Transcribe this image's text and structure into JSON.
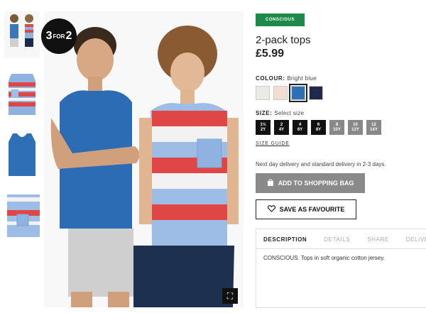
{
  "product": {
    "badge": {
      "big_left": "3",
      "small": "FOR",
      "big_right": "2"
    },
    "tag": "CONSCIOUS",
    "title": "2-pack tops",
    "price": "£5.99"
  },
  "colour": {
    "label": "COLOUR:",
    "value": "Bright blue",
    "swatches": [
      {
        "name": "light-grey",
        "color": "#eceae6"
      },
      {
        "name": "light-pink",
        "color": "#f1ddd2"
      },
      {
        "name": "bright-blue",
        "color": "#2f6fb5"
      },
      {
        "name": "dark-blue",
        "color": "#1f2a4a"
      }
    ]
  },
  "size": {
    "label": "SIZE:",
    "value": "Select size",
    "options": [
      {
        "label": "1½\n2Y",
        "available": true
      },
      {
        "label": "2\n4Y",
        "available": true
      },
      {
        "label": "4\n6Y",
        "available": true
      },
      {
        "label": "6\n8Y",
        "available": true
      },
      {
        "label": "8\n10Y",
        "available": false
      },
      {
        "label": "10\n12Y",
        "available": false
      },
      {
        "label": "12\n14Y",
        "available": false
      }
    ],
    "guide": "SIZE GUIDE"
  },
  "delivery_text": "Next day delivery and standard delivery in 2-3 days.",
  "buttons": {
    "add_to_bag": "ADD TO SHOPPING BAG",
    "favourite": "SAVE AS FAVOURITE"
  },
  "tabs": [
    "DESCRIPTION",
    "DETAILS",
    "SHARE",
    "DELIVERY"
  ],
  "description": "CONSCIOUS. Tops in soft organic cotton jersey.",
  "icons": [
    "bag-icon",
    "heart-icon",
    "fullscreen-icon"
  ]
}
